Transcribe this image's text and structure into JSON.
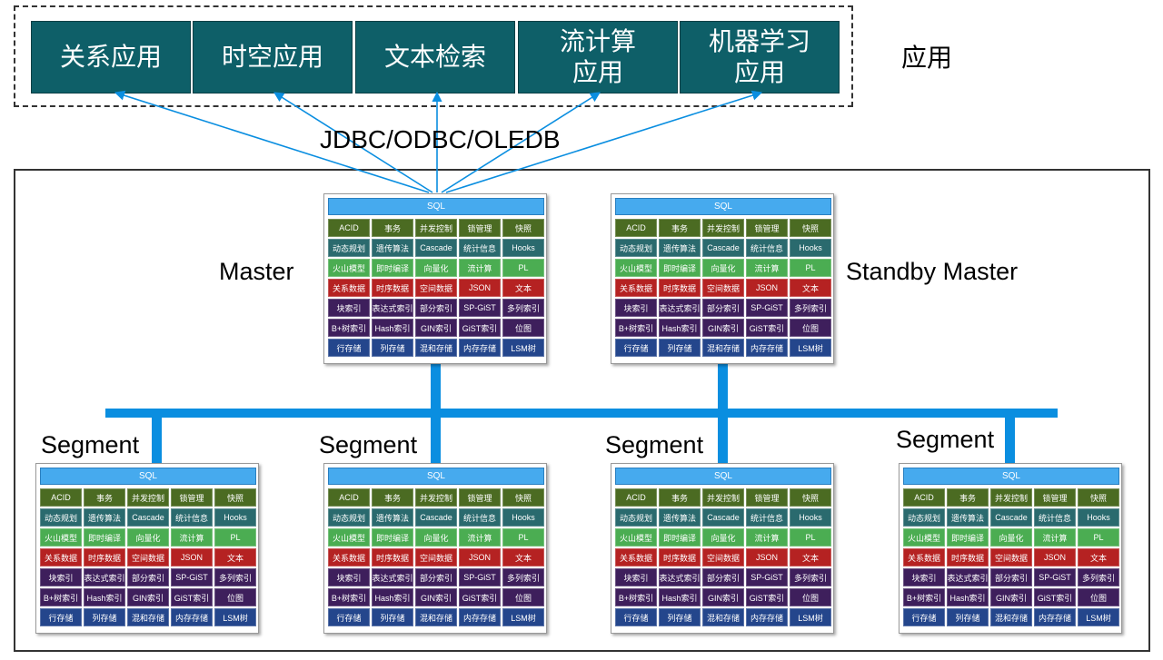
{
  "applications": {
    "label": "应用",
    "items": [
      {
        "label": "关系应用"
      },
      {
        "label": "时空应用"
      },
      {
        "label": "文本检索"
      },
      {
        "label": "流计算\n应用"
      },
      {
        "label": "机器学习\n应用"
      }
    ]
  },
  "protocol_label": "JDBC/ODBC/OLEDB",
  "roles": {
    "master": "Master",
    "standby_master": "Standby Master",
    "segment": "Segment"
  },
  "node_panel": {
    "header": "SQL",
    "rows": [
      {
        "color": "#4b6b22",
        "cells": [
          "ACID",
          "事务",
          "并发控制",
          "锁管理",
          "快照"
        ]
      },
      {
        "color": "#2a6a6e",
        "cells": [
          "动态规划",
          "遗传算法",
          "Cascade",
          "统计信息",
          "Hooks"
        ]
      },
      {
        "color": "#4bad52",
        "cells": [
          "火山模型",
          "即时编译",
          "向量化",
          "流计算",
          "PL"
        ]
      },
      {
        "color": "#b52222",
        "cells": [
          "关系数据",
          "时序数据",
          "空间数据",
          "JSON",
          "文本"
        ]
      },
      {
        "color": "#3e1f5c",
        "cells": [
          "块索引",
          "表达式索引",
          "部分索引",
          "SP-GiST",
          "多列索引"
        ]
      },
      {
        "color": "#3e1f5c",
        "cells": [
          "B+树索引",
          "Hash索引",
          "GIN索引",
          "GiST索引",
          "位图"
        ]
      },
      {
        "color": "#24468c",
        "cells": [
          "行存储",
          "列存储",
          "混和存储",
          "内存存储",
          "LSM树"
        ]
      }
    ]
  }
}
